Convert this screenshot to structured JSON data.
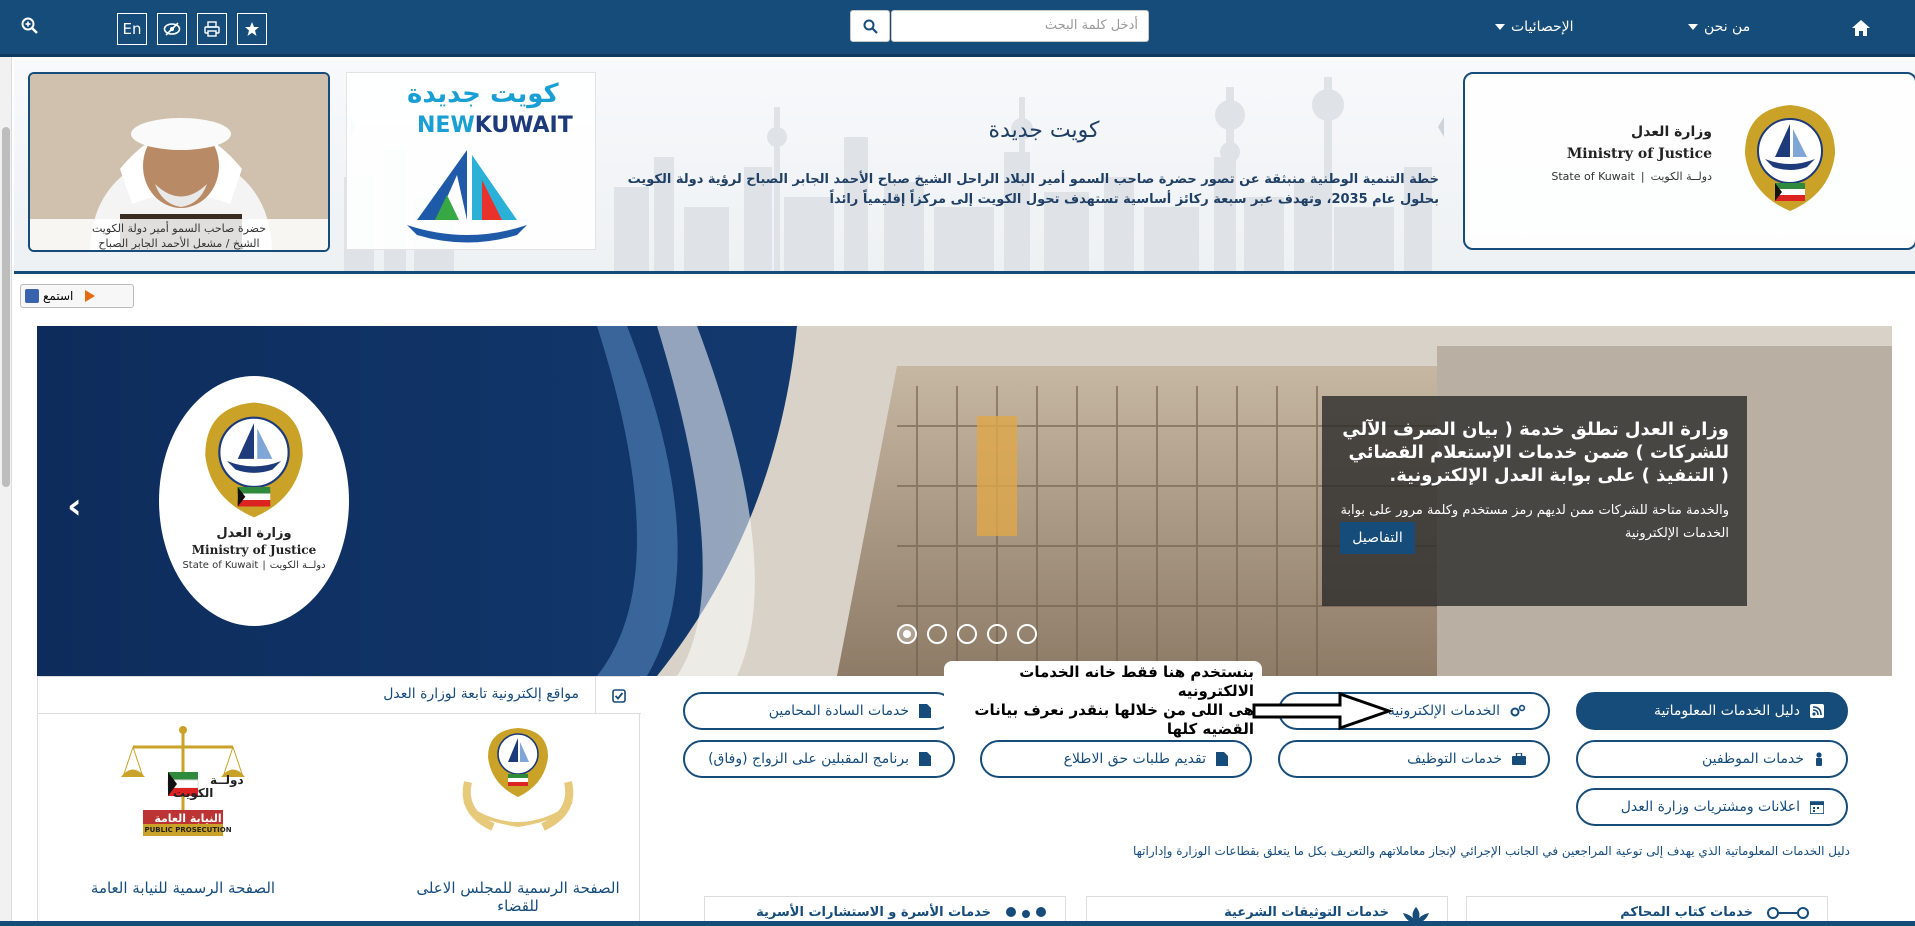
{
  "topbar": {
    "zoom_icon": "zoom-in-icon",
    "lang_label": "En",
    "search_placeholder": "أدخل كلمة البحث",
    "nav_statistics": "الإحصائيات",
    "nav_about": "من نحن",
    "home_icon": "home-icon",
    "background_color": "#164c7a"
  },
  "banner": {
    "title": "كويت جديدة",
    "text": "خطة التنمية الوطنية منبثقة عن تصور حضرة صاحب السمو أمير البلاد الراحل الشيخ صباح الأحمد الجابر الصباح لرؤية دولة الكويت بحلول عام 2035، وتهدف عبر سبعة ركائز أساسية تستهدف تحول الكويت إلى مركزاً إقليمياً رائداً",
    "newkuwait_ar": "كويت جديدة",
    "newkuwait_en_new": "NEW",
    "newkuwait_en_kuwait": "KUWAIT",
    "portrait_caption_1": "حضرة صاحب السمو أمير دولة الكويت",
    "portrait_caption_2": "الشيخ / مشعل الأحمد الجابر الصباح",
    "moj_ar": "وزارة العدل",
    "moj_en": "Ministry of Justice",
    "moj_state_en": "State of Kuwait",
    "moj_state_ar": "دولــة الكويت"
  },
  "listen": {
    "label": "استمع"
  },
  "hero": {
    "headline": "وزارة العدل تطلق خدمة ( بيان الصرف الآلي للشركات ) ضمن خدمات الإستعلام القضائي ( التنفيذ ) على بوابة العدل الإلكترونية.",
    "body": "والخدمة متاحة للشركات ممن لديهم رمز مستخدم وكلمة مرور على بوابة الخدمات الإلكترونية",
    "details_button": "التفاصيل",
    "logo_ar": "وزارة العدل",
    "logo_en": "Ministry of Justice",
    "logo_state_en": "State of Kuwait",
    "logo_state_ar": "دولــة الكويت",
    "slide_count": 5,
    "active_slide": 1
  },
  "services": {
    "info_guide": "دليل الخدمات المعلوماتية",
    "eservices": "الخدمات الإلكترونية",
    "lawyers": "خدمات السادة المحامين",
    "employees": "خدمات الموظفين",
    "employment": "خدمات التوظيف",
    "access_requests": "تقديم طلبات حق الاطلاع",
    "marriage_program": "برنامج المقبلين على الزواج (وفاق)",
    "ads": "اعلانات ومشتريات وزارة العدل",
    "info_text": "دليل الخدمات المعلوماتية الذي يهدف إلى توعية المراجعين في الجانب الإجرائي لإنجاز معاملاتهم والتعريف بكل ما يتعلق بقطاعات الوزارة وإداراتها"
  },
  "annotation": {
    "line1": "بنستخدم هنا فقط خانه الخدمات الالكترونيه",
    "line2": "هى اللى من خلالها بنقدر نعرف بيانات",
    "line3": "القضيه كلها"
  },
  "sites_panel": {
    "title": "مواقع إلكترونية تابعة لوزارة العدل",
    "judiciary_caption": "الصفحة الرسمية للمجلس الاعلى للقضاء",
    "prosecution_caption": "الصفحة الرسمية للنيابة العامة",
    "prosecution_ar1": "دولــة",
    "prosecution_ar2": "الكويت",
    "prosecution_ar3": "النيابة العامة",
    "prosecution_en": "PUBLIC PROSECUTION"
  },
  "bottom_cards": {
    "courts": "خدمات كتاب المحاكم",
    "notary": "خدمات التوثيقات الشرعية",
    "family": "خدمات الأسرة و الاستشارات الأسرية"
  }
}
